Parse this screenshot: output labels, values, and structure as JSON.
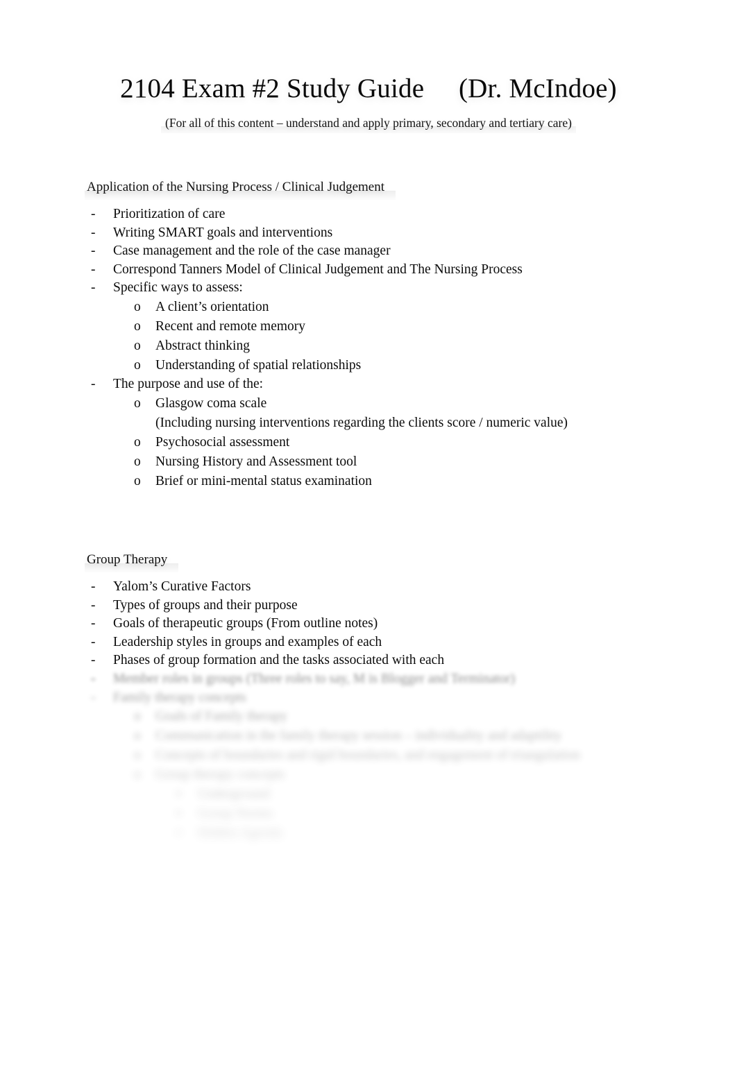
{
  "document": {
    "title": "2104 Exam #2 Study Guide     (Dr. McIndoe)",
    "subtitle": "(For all of this content – understand and apply primary, secondary and tertiary care)",
    "page_background": "#ffffff",
    "text_color": "#0a0a0a"
  },
  "sections": [
    {
      "heading": "Application of the Nursing Process / Clinical Judgement",
      "items": [
        {
          "level": 1,
          "marker": "-",
          "text": "Prioritization of care"
        },
        {
          "level": 1,
          "marker": "-",
          "text": "Writing SMART goals and interventions"
        },
        {
          "level": 1,
          "marker": "-",
          "text": "Case management and the role of the case manager"
        },
        {
          "level": 1,
          "marker": "-",
          "text": "Correspond Tanners Model of Clinical Judgement and The Nursing Process"
        },
        {
          "level": 1,
          "marker": "-",
          "text": "Specific ways to assess:"
        },
        {
          "level": 2,
          "marker": "o",
          "text": "A client’s orientation"
        },
        {
          "level": 2,
          "marker": "o",
          "text": "Recent and remote memory"
        },
        {
          "level": 2,
          "marker": "o",
          "text": "Abstract thinking"
        },
        {
          "level": 2,
          "marker": "o",
          "text": "Understanding of spatial relationships"
        },
        {
          "level": 1,
          "marker": "-",
          "text": "The purpose and use of the:"
        },
        {
          "level": 2,
          "marker": "o",
          "text": "Glasgow coma scale"
        },
        {
          "level": 2,
          "marker": "",
          "text": "(Including nursing interventions regarding the clients score / numeric value)"
        },
        {
          "level": 2,
          "marker": "o",
          "text": "Psychosocial assessment"
        },
        {
          "level": 2,
          "marker": "o",
          "text": "Nursing History and Assessment tool"
        },
        {
          "level": 2,
          "marker": "o",
          "text": "Brief or mini-mental status examination"
        }
      ]
    },
    {
      "heading": "Group Therapy",
      "items": [
        {
          "level": 1,
          "marker": "-",
          "text": "Yalom’s Curative Factors"
        },
        {
          "level": 1,
          "marker": "-",
          "text": "Types of groups and their purpose"
        },
        {
          "level": 1,
          "marker": "-",
          "text": "Goals of therapeutic groups (From outline notes)"
        },
        {
          "level": 1,
          "marker": "-",
          "text": "Leadership styles in groups and examples of each"
        },
        {
          "level": 1,
          "marker": "-",
          "text": "Phases of group formation and the tasks associated with each"
        }
      ],
      "obscured_items": [
        {
          "level": 1,
          "marker": "-",
          "text": "Member roles in groups (Three roles to say, M is Blogger and Terminator)",
          "blur": "blur-a",
          "marker_sharp": true
        },
        {
          "level": 1,
          "marker": "-",
          "text": "Family therapy concepts",
          "blur": "blur-b",
          "marker_sharp": false
        },
        {
          "level": 2,
          "marker": "o",
          "text": "Goals of Family therapy",
          "blur": "blur-c",
          "marker_sharp": false
        },
        {
          "level": 2,
          "marker": "o",
          "text": "Communication in the family therapy session – individuality and adaptility",
          "blur": "blur-d",
          "marker_sharp": false
        },
        {
          "level": 2,
          "marker": "o",
          "text": "Concepts of boundaries and rigid boundaries, and engagement of triangulation",
          "blur": "blur-e",
          "marker_sharp": false
        },
        {
          "level": 2,
          "marker": "o",
          "text": "Group therapy concepts",
          "blur": "blur-f",
          "marker_sharp": false
        },
        {
          "level": 3,
          "marker": "▪",
          "text": "Underground",
          "blur": "blur-g",
          "marker_sharp": false
        },
        {
          "level": 3,
          "marker": "▪",
          "text": "Group Norms",
          "blur": "blur-h",
          "marker_sharp": false
        },
        {
          "level": 3,
          "marker": "▪",
          "text": "Hidden Agenda",
          "blur": "blur-i",
          "marker_sharp": false
        }
      ]
    }
  ]
}
